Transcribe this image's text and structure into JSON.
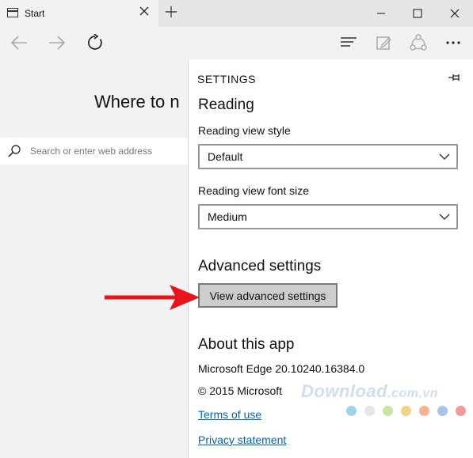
{
  "tab": {
    "title": "Start"
  },
  "start_page": {
    "heading": "Where to n",
    "search_placeholder": "Search or enter web address"
  },
  "settings": {
    "title": "SETTINGS",
    "reading": {
      "heading": "Reading",
      "view_style_label": "Reading view style",
      "view_style_value": "Default",
      "font_size_label": "Reading view font size",
      "font_size_value": "Medium"
    },
    "advanced": {
      "heading": "Advanced settings",
      "button_label": "View advanced settings"
    },
    "about": {
      "heading": "About this app",
      "version": "Microsoft Edge 20.10240.16384.0",
      "copyright": "© 2015 Microsoft",
      "terms_link": "Terms of use",
      "privacy_link": "Privacy statement"
    }
  },
  "watermark": {
    "text": "Download",
    "suffix": ".com.vn",
    "dot_colors": [
      "#9fd3ec",
      "#e6e6e6",
      "#c8e6a0",
      "#f4d28a",
      "#f7b48c",
      "#a9c4ea",
      "#f29a9a"
    ]
  },
  "annotation": {
    "arrow_color": "#e8141c"
  },
  "icons": {
    "tab": "tab-icon",
    "close": "close-icon",
    "new_tab": "plus-icon",
    "minimize": "minimize-icon",
    "maximize": "maximize-icon",
    "window_close": "close-icon",
    "back": "back-arrow-icon",
    "forward": "forward-arrow-icon",
    "refresh": "refresh-icon",
    "hub": "hub-icon",
    "web_note": "web-note-icon",
    "share": "share-icon",
    "more": "more-icon",
    "search": "search-icon",
    "pin": "pin-icon",
    "chevron": "chevron-down-icon"
  }
}
